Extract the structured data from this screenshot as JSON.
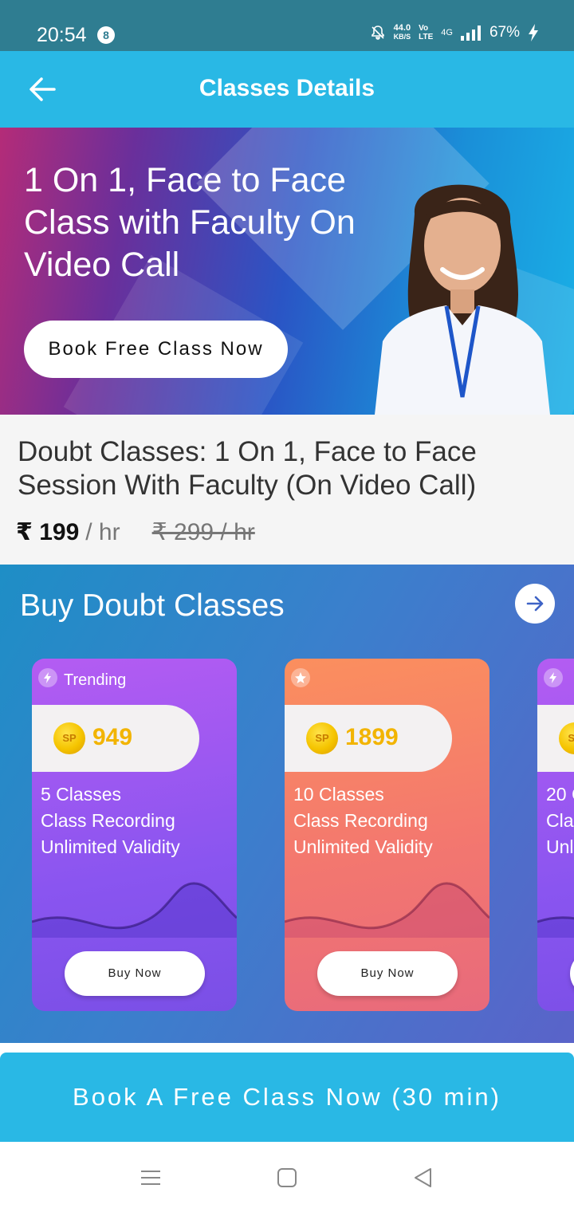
{
  "status_bar": {
    "time": "20:54",
    "notification_count": "8",
    "net_speed_value": "44.0",
    "net_speed_unit": "KB/S",
    "volte_top": "Vo",
    "volte_bottom": "LTE",
    "network": "4G",
    "battery": "67%"
  },
  "app_bar": {
    "title": "Classes Details",
    "back_icon": "arrow-left-icon"
  },
  "hero": {
    "title": "1 On 1, Face to Face Class with Faculty On Video Call",
    "button_label": "Book Free Class Now"
  },
  "class_info": {
    "title": "Doubt Classes: 1 On 1, Face to Face Session With Faculty (On Video Call)",
    "price": "₹ 199",
    "price_unit": "/ hr",
    "old_price": "₹ 299 / hr"
  },
  "buy_section": {
    "title": "Buy Doubt Classes",
    "more_icon": "arrow-right-icon",
    "packages": [
      {
        "tag": "Trending",
        "badge_icon": "lightning-icon",
        "coin_label": "SP",
        "points": "949",
        "features": [
          "5 Classes",
          "Class Recording",
          "Unlimited Validity"
        ],
        "button_label": "Buy Now"
      },
      {
        "tag": "",
        "badge_icon": "star-icon",
        "coin_label": "SP",
        "points": "1899",
        "features": [
          "10 Classes",
          "Class Recording",
          "Unlimited Validity"
        ],
        "button_label": "Buy Now"
      },
      {
        "tag": "",
        "badge_icon": "lightning-icon",
        "coin_label": "SP",
        "points": "",
        "features": [
          "20 C",
          "Cla",
          "Unl"
        ],
        "button_label": ""
      }
    ]
  },
  "cta": {
    "label": "Book A Free Class Now (30 min)"
  },
  "nav_bar": {
    "icons": [
      "menu-icon",
      "home-square-icon",
      "back-triangle-icon"
    ]
  },
  "colors": {
    "status_bar": "#2f7d91",
    "app_bar": "#29b8e5",
    "points": "#f2b400",
    "purple_card": "#8a55f0",
    "orange_card": "#f3776f"
  }
}
